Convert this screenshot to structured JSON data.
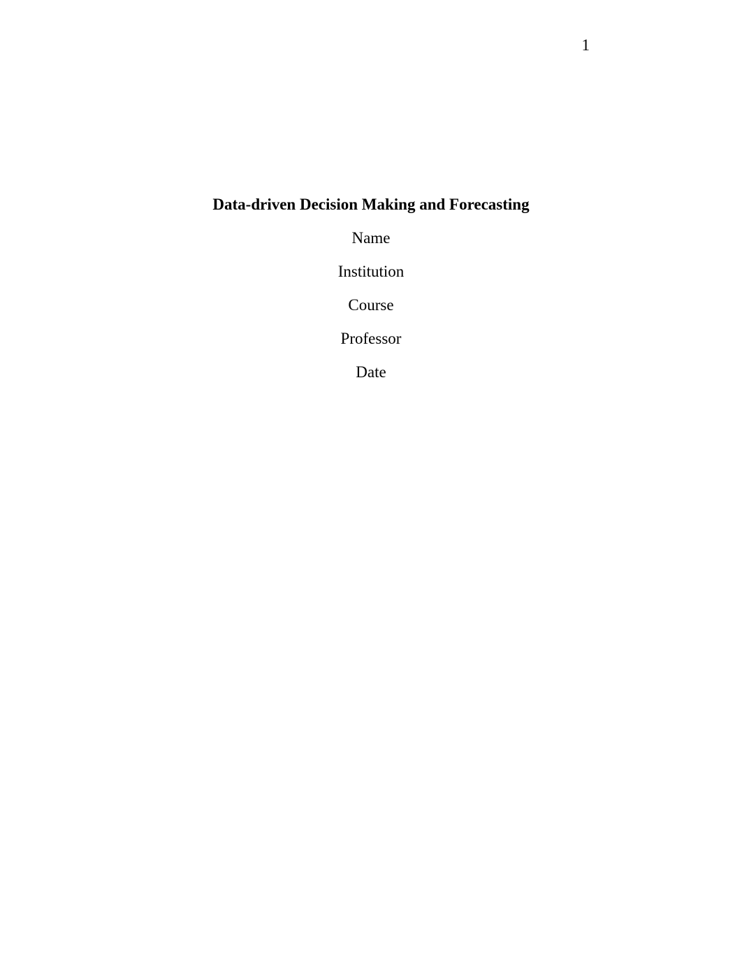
{
  "page_number": "1",
  "title": "Data-driven Decision Making and Forecasting",
  "fields": {
    "name": "Name",
    "institution": "Institution",
    "course": "Course",
    "professor": "Professor",
    "date": "Date"
  }
}
